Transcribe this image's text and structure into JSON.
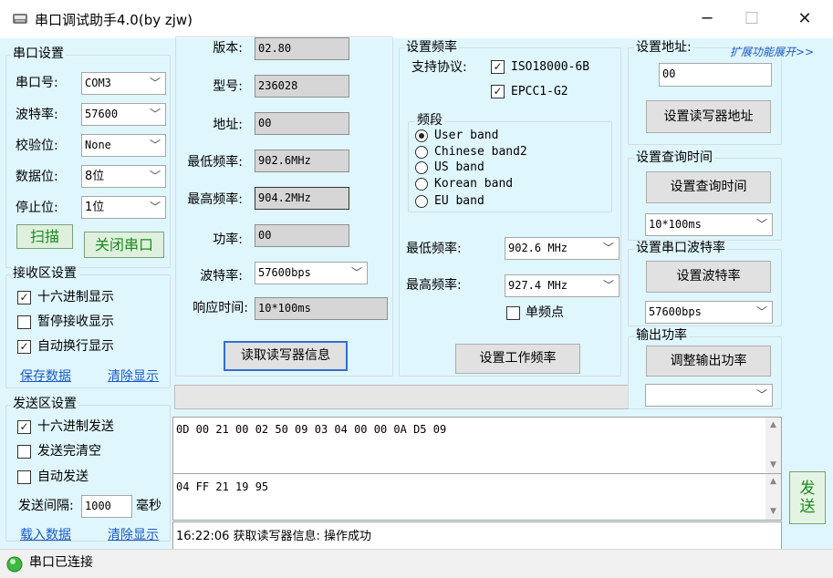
{
  "window": {
    "title": "串口调试助手4.0(by zjw)",
    "minimize": "─",
    "maximize": "☐",
    "close": "✕"
  },
  "serial": {
    "title": "串口设置",
    "port_label": "串口号:",
    "port_value": "COM3",
    "baud_label": "波特率:",
    "baud_value": "57600",
    "parity_label": "校验位:",
    "parity_value": "None",
    "databits_label": "数据位:",
    "databits_value": "8位",
    "stopbits_label": "停止位:",
    "stopbits_value": "1位",
    "scan_button": "扫描",
    "close_button": "关闭串口"
  },
  "receive": {
    "title": "接收区设置",
    "hex_display": "十六进制显示",
    "hex_display_checked": "✓",
    "pause": "暂停接收显示",
    "pause_checked": "",
    "autowrap": "自动换行显示",
    "autowrap_checked": "✓",
    "save_link": "保存数据",
    "clear_link": "清除显示"
  },
  "send": {
    "title": "发送区设置",
    "hex_send": "十六进制发送",
    "hex_send_checked": "✓",
    "clear_after": "发送完清空",
    "clear_after_checked": "",
    "auto_send": "自动发送",
    "auto_send_checked": "",
    "interval_label": "发送间隔:",
    "interval_value": "1000",
    "interval_unit": "毫秒",
    "load_link": "载入数据",
    "clear_link": "清除显示"
  },
  "reader_info": {
    "version_label": "版本:",
    "version_value": "02.80",
    "model_label": "型号:",
    "model_value": "236028",
    "address_label": "地址:",
    "address_value": "00",
    "minfreq_label": "最低频率:",
    "minfreq_value": "902.6MHz",
    "maxfreq_label": "最高频率:",
    "maxfreq_value": "904.2MHz",
    "power_label": "功率:",
    "power_value": "00",
    "baud_label": "波特率:",
    "baud_value": "57600bps",
    "response_label": "响应时间:",
    "response_value": "10*100ms",
    "read_button": "读取读写器信息"
  },
  "freq": {
    "title": "设置频率",
    "protocol_label": "支持协议:",
    "proto1": "ISO18000-6B",
    "proto1_checked": "✓",
    "proto2": "EPCC1-G2",
    "proto2_checked": "✓",
    "band_title": "频段",
    "bands": [
      "User band",
      "Chinese band2",
      "US band",
      "Korean band",
      "EU band"
    ],
    "minfreq_label": "最低频率:",
    "minfreq_value": "902.6 MHz",
    "maxfreq_label": "最高频率:",
    "maxfreq_value": "927.4 MHz",
    "single_label": "单频点",
    "single_checked": "",
    "set_button": "设置工作频率"
  },
  "right": {
    "addr_title": "设置地址:",
    "expand_link": "扩展功能展开>>",
    "addr_value": "00",
    "addr_button": "设置读写器地址",
    "query_title": "设置查询时间",
    "query_button": "设置查询时间",
    "query_value": "10*100ms",
    "baud_title": "设置串口波特率",
    "baud_button": "设置波特率",
    "baud_value": "57600bps",
    "power_title": "输出功率",
    "power_button": "调整输出功率",
    "power_value": ""
  },
  "io": {
    "receive_text": "0D 00 21 00 02 50 09 03 04 00 00 0A D5 09",
    "send_text": "04 FF 21 19 95",
    "send_button": "发送",
    "log_text": "16:22:06 获取读写器信息: 操作成功"
  },
  "status": {
    "text": "串口已连接"
  }
}
